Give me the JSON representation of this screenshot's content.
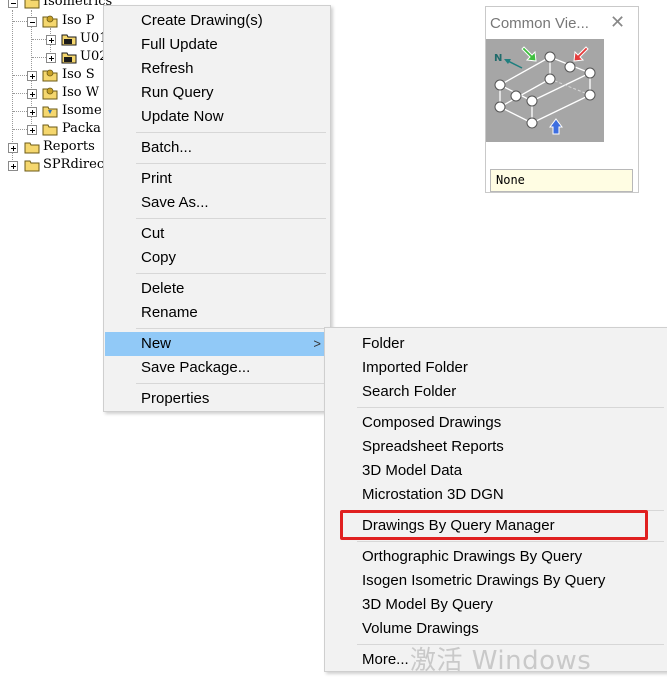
{
  "tree": {
    "items": [
      {
        "label": "Isometrics"
      },
      {
        "label": "Iso P"
      },
      {
        "label": "U01"
      },
      {
        "label": "U02"
      },
      {
        "label": "Iso S"
      },
      {
        "label": "Iso W"
      },
      {
        "label": "Isome"
      },
      {
        "label": "Packa"
      },
      {
        "label": "Reports"
      },
      {
        "label": "SPRdirec"
      }
    ]
  },
  "context_menu": {
    "items": [
      {
        "label": "Create Drawing(s)"
      },
      {
        "label": "Full Update"
      },
      {
        "label": "Refresh"
      },
      {
        "label": "Run Query"
      },
      {
        "label": "Update Now"
      },
      {
        "label": "Batch..."
      },
      {
        "label": "Print"
      },
      {
        "label": "Save As..."
      },
      {
        "label": "Cut"
      },
      {
        "label": "Copy"
      },
      {
        "label": "Delete"
      },
      {
        "label": "Rename"
      },
      {
        "label": "New",
        "submenu_arrow": ">"
      },
      {
        "label": "Save Package..."
      },
      {
        "label": "Properties"
      }
    ],
    "highlighted": "New"
  },
  "submenu": {
    "items": [
      {
        "label": "Folder"
      },
      {
        "label": "Imported Folder"
      },
      {
        "label": "Search Folder"
      },
      {
        "label": "Composed Drawings"
      },
      {
        "label": "Spreadsheet Reports"
      },
      {
        "label": "3D Model Data"
      },
      {
        "label": "Microstation 3D DGN"
      },
      {
        "label": "Drawings By Query Manager"
      },
      {
        "label": "Orthographic Drawings By Query"
      },
      {
        "label": "Isogen Isometric Drawings By Query"
      },
      {
        "label": "3D Model By Query"
      },
      {
        "label": "Volume Drawings"
      },
      {
        "label": "More..."
      }
    ],
    "annotated_item": "Drawings By Query Manager"
  },
  "common_views": {
    "title": "Common Vie...",
    "close_glyph": "✕",
    "north_label": "N",
    "selected_value": "None"
  },
  "watermark": {
    "text": "激活 Windows"
  },
  "colors": {
    "highlight": "#91c9f7",
    "annotation_red": "#e02020",
    "menu_bg": "#f2f2f2",
    "cube_bg": "#a6a6a6",
    "field_bg": "#fffde3"
  },
  "icons": [
    "folder-icon",
    "folder-open-icon",
    "expander-minus-icon",
    "expander-plus-icon",
    "close-icon",
    "submenu-arrow-icon",
    "view-cube-icon",
    "north-arrow-icon"
  ]
}
